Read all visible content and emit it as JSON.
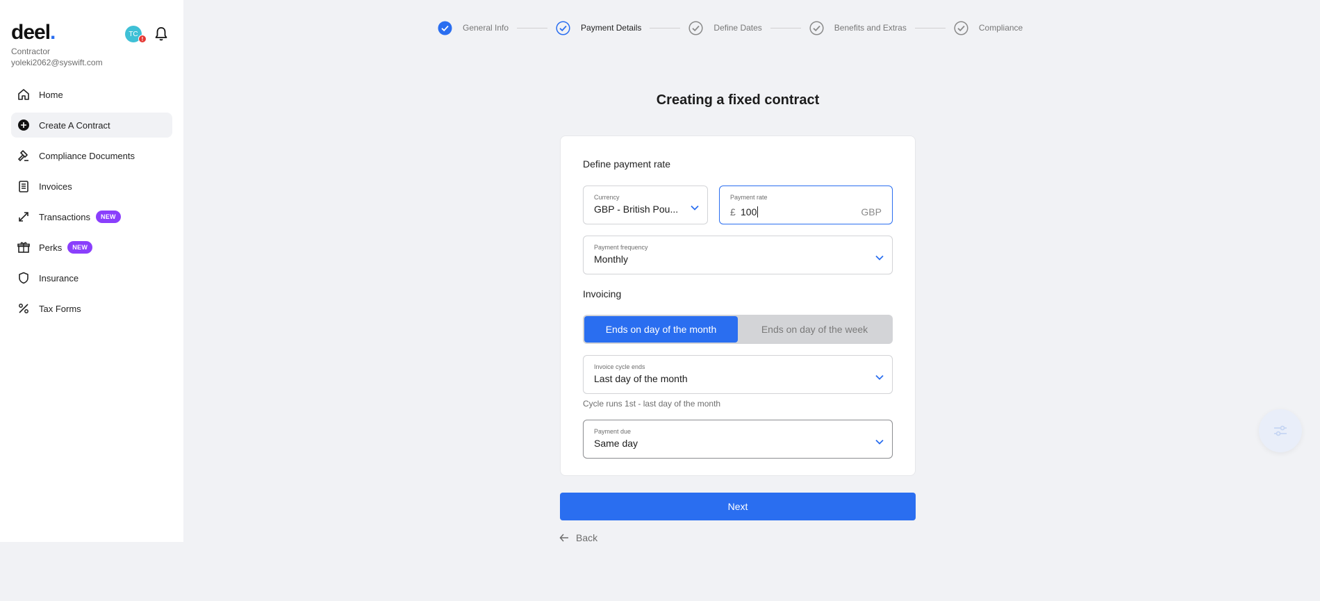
{
  "sidebar": {
    "logo": "deel",
    "role": "Contractor",
    "email": "yoleki2062@syswift.com",
    "avatar_initials": "TC",
    "avatar_badge": "!",
    "items": [
      {
        "label": "Home",
        "icon": "home-icon"
      },
      {
        "label": "Create A Contract",
        "icon": "plus-circle-icon",
        "active": true
      },
      {
        "label": "Compliance Documents",
        "icon": "gavel-icon"
      },
      {
        "label": "Invoices",
        "icon": "invoice-icon"
      },
      {
        "label": "Transactions",
        "icon": "arrows-diagonal-icon",
        "badge": "NEW"
      },
      {
        "label": "Perks",
        "icon": "gift-icon",
        "badge": "NEW"
      },
      {
        "label": "Insurance",
        "icon": "shield-icon"
      },
      {
        "label": "Tax Forms",
        "icon": "percent-icon"
      }
    ]
  },
  "stepper": {
    "steps": [
      {
        "label": "General Info",
        "state": "done"
      },
      {
        "label": "Payment Details",
        "state": "current"
      },
      {
        "label": "Define Dates",
        "state": "pending"
      },
      {
        "label": "Benefits and Extras",
        "state": "pending"
      },
      {
        "label": "Compliance",
        "state": "pending"
      }
    ]
  },
  "main": {
    "title": "Creating a fixed contract",
    "rate_section_label": "Define payment rate",
    "currency": {
      "label": "Currency",
      "value": "GBP - British Pou..."
    },
    "payment_rate": {
      "label": "Payment rate",
      "symbol": "£",
      "value": "100",
      "suffix": "GBP"
    },
    "frequency": {
      "label": "Payment frequency",
      "value": "Monthly"
    },
    "invoicing_label": "Invoicing",
    "invoicing_toggle": {
      "option_month": "Ends on day of the month",
      "option_week": "Ends on day of the week",
      "selected": "month"
    },
    "invoice_cycle": {
      "label": "Invoice cycle ends",
      "value": "Last day of the month"
    },
    "cycle_hint": "Cycle runs 1st - last day of the month",
    "payment_due": {
      "label": "Payment due",
      "value": "Same day"
    },
    "next_label": "Next",
    "back_label": "Back"
  },
  "colors": {
    "accent": "#2a6ef0",
    "badge": "#8a3ffc",
    "background": "#f1f2f5"
  }
}
